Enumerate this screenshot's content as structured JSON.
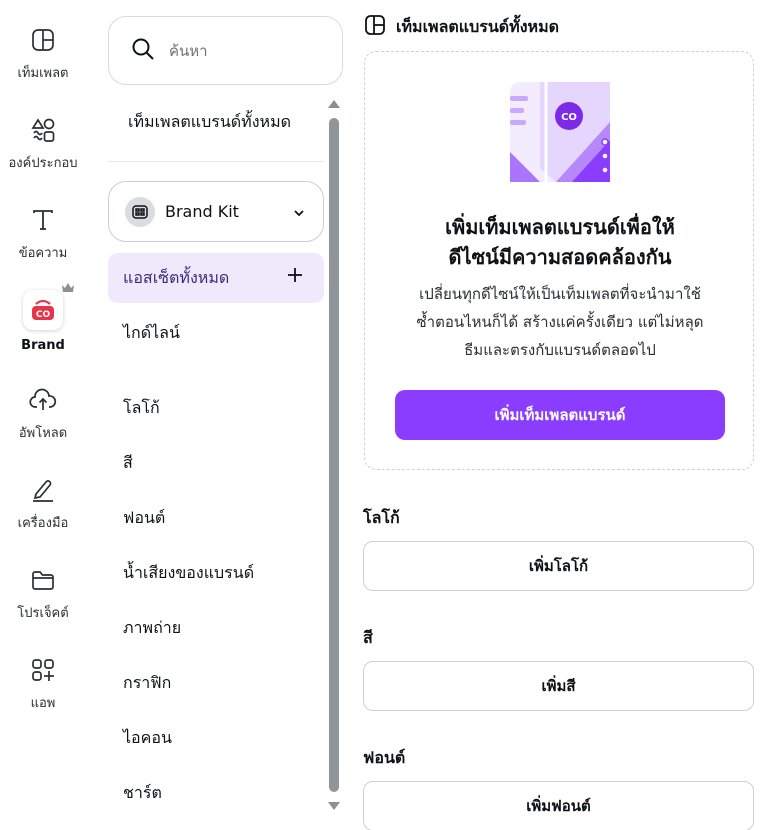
{
  "rail": {
    "items": [
      {
        "label": "เท็มเพลต",
        "icon": "template-icon"
      },
      {
        "label": "องค์ประกอบ",
        "icon": "elements-icon"
      },
      {
        "label": "ข้อความ",
        "icon": "text-icon"
      },
      {
        "label": "Brand",
        "icon": "brand-icon"
      },
      {
        "label": "อัพโหลด",
        "icon": "upload-icon"
      },
      {
        "label": "เครื่องมือ",
        "icon": "tools-icon"
      },
      {
        "label": "โปรเจ็คต์",
        "icon": "folder-icon"
      },
      {
        "label": "แอพ",
        "icon": "apps-icon"
      }
    ],
    "brand_logo_text": "CO"
  },
  "search": {
    "placeholder": "ค้นหา"
  },
  "panel": {
    "all_templates": "เท็มเพลตแบรนด์ทั้งหมด",
    "kit_label": "Brand Kit",
    "all_assets": "แอสเซ็ตทั้งหมด",
    "nav": [
      "ไกด์ไลน์",
      "โลโก้",
      "สี",
      "ฟอนต์",
      "น้ำเสียงของแบรนด์",
      "ภาพถ่าย",
      "กราฟิก",
      "ไอคอน",
      "ชาร์ต"
    ]
  },
  "main": {
    "header": "เท็มเพลตแบรนด์ทั้งหมด",
    "promo": {
      "badge_text": "CO",
      "title_line1": "เพิ่มเท็มเพลตแบรนด์เพื่อให้",
      "title_line2": "ดีไซน์มีความสอดคล้องกัน",
      "desc_line1": "เปลี่ยนทุกดีไซน์ให้เป็นเท็มเพลตที่จะนำมาใช้",
      "desc_line2": "ซ้ำตอนไหนก็ได้ สร้างแค่ครั้งเดียว แต่ไม่หลุด",
      "desc_line3": "ธีมและตรงกับแบรนด์ตลอดไป",
      "button": "เพิ่มเท็มเพลตแบรนด์"
    },
    "sections": [
      {
        "label": "โลโก้",
        "button": "เพิ่มโลโก้"
      },
      {
        "label": "สี",
        "button": "เพิ่มสี"
      },
      {
        "label": "ฟอนต์",
        "button": "เพิ่มฟอนต์"
      }
    ]
  },
  "colors": {
    "accent": "#8b3dff",
    "brand_red": "#e8334a",
    "selected_bg": "#efe9fb"
  }
}
